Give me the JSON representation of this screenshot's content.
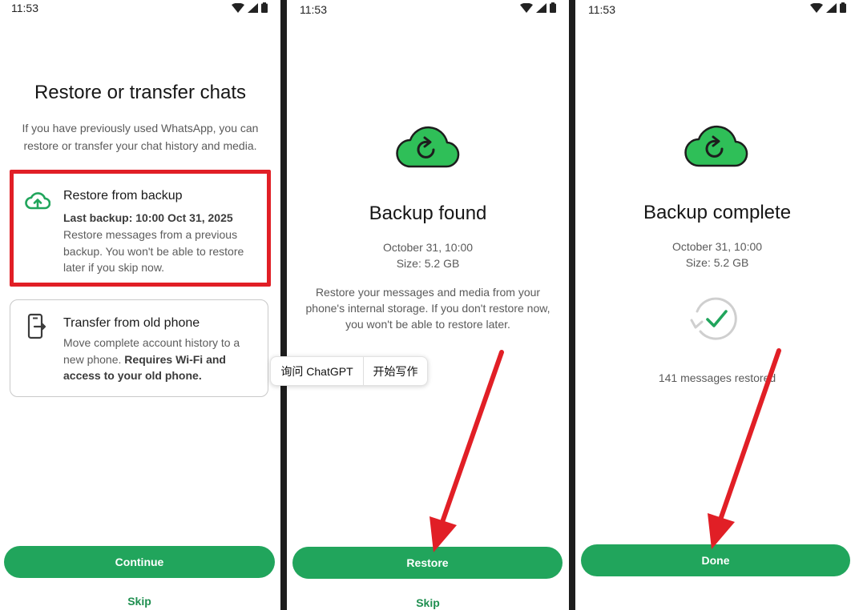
{
  "status_bar": {
    "time": "11:53"
  },
  "screen1": {
    "title": "Restore or transfer chats",
    "description": "If you have previously used WhatsApp, you can restore or transfer your chat history and media.",
    "restore_option": {
      "title": "Restore from backup",
      "last_backup": "Last backup: 10:00 Oct 31, 2025",
      "text": "Restore messages from a previous backup. You won't be able to restore later if you skip now."
    },
    "transfer_option": {
      "title": "Transfer from old phone",
      "text_plain": "Move complete account history to a new phone.",
      "text_bold": "Requires Wi-Fi and access to your old phone."
    },
    "continue_label": "Continue",
    "skip_label": "Skip"
  },
  "screen2": {
    "title": "Backup found",
    "date": "October 31, 10:00",
    "size": "Size: 5.2 GB",
    "description": "Restore your messages and media from your phone's internal storage. If you don't restore now, you won't be able to restore later.",
    "restore_label": "Restore",
    "skip_label": "Skip"
  },
  "screen3": {
    "title": "Backup complete",
    "date": "October 31, 10:00",
    "size": "Size: 5.2 GB",
    "messages": "141 messages restored",
    "done_label": "Done"
  },
  "popup": {
    "ask_label": "询问 ChatGPT",
    "write_label": "开始写作"
  },
  "colors": {
    "accent": "#21a55c",
    "highlight": "#e11f26",
    "cloud": "#2fbf58"
  },
  "icons": [
    "wifi-icon",
    "signal-icon",
    "battery-icon",
    "cloud-upload-icon",
    "phone-transfer-icon",
    "cloud-restore-icon",
    "check-sync-icon"
  ]
}
